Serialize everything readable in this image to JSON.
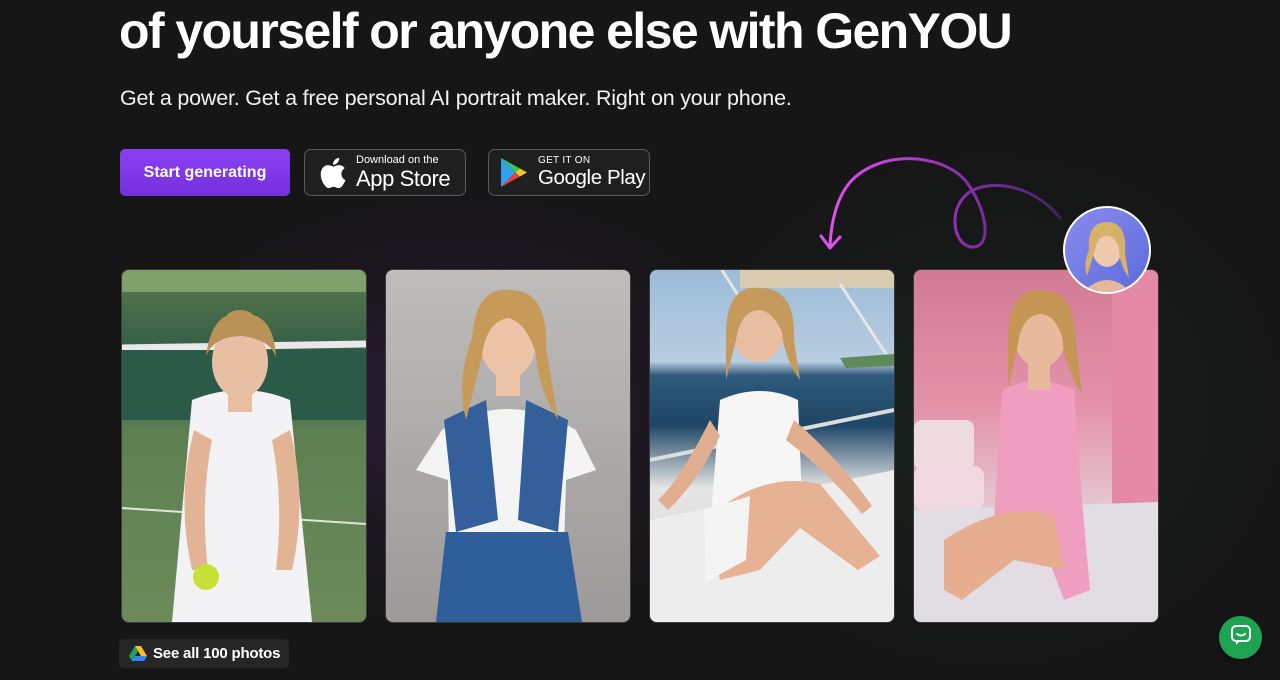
{
  "hero": {
    "headline": "of yourself or anyone else with GenYOU",
    "subheadline": "Get a power. Get a free personal AI portrait maker. Right on your phone."
  },
  "actions": {
    "primary_label": "Start generating",
    "app_store": {
      "small": "Download on the",
      "large": "App Store",
      "icon": "apple-icon"
    },
    "google_play": {
      "small": "GET IT ON",
      "large": "Google Play",
      "icon": "google-play-icon"
    }
  },
  "gallery": {
    "photos": [
      {
        "scene": "tennis-court",
        "icon": "portrait-photo"
      },
      {
        "scene": "studio-denim",
        "icon": "portrait-photo"
      },
      {
        "scene": "yacht-sea",
        "icon": "portrait-photo"
      },
      {
        "scene": "pink-bedroom",
        "icon": "portrait-photo"
      }
    ],
    "source_avatar_icon": "avatar-portrait",
    "see_all_label": "See all 100 photos",
    "see_all_icon": "google-drive-icon"
  },
  "colors": {
    "background": "#161616",
    "accent": "#7b35e8",
    "arrow": "#d94be6",
    "chat": "#1ea353"
  },
  "chat": {
    "icon": "chat-bubble-icon"
  }
}
